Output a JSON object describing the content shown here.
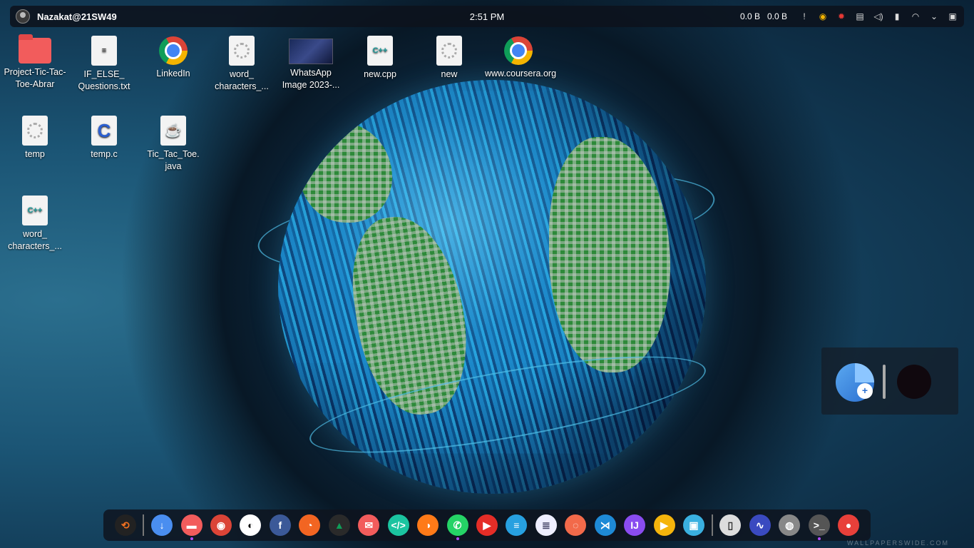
{
  "topbar": {
    "user": "Nazakat@21SW49",
    "clock": "2:51 PM",
    "net_down": "0.0 B",
    "net_up": "0.0 B",
    "tray_icons": [
      "notification-icon",
      "chrome-icon",
      "settings-gear-icon",
      "clipboard-icon",
      "volume-icon",
      "battery-icon",
      "wifi-icon",
      "chevron-down-icon",
      "screen-icon"
    ]
  },
  "desktop": {
    "icons": [
      {
        "label": "Project-Tic-Tac-Toe-Abrar",
        "kind": "folder"
      },
      {
        "label": "IF_ELSE_ Questions.txt",
        "kind": "text"
      },
      {
        "label": "LinkedIn",
        "kind": "chrome"
      },
      {
        "label": "word_ characters_...",
        "kind": "exec"
      },
      {
        "label": "WhatsApp Image 2023-...",
        "kind": "image"
      },
      {
        "label": "new.cpp",
        "kind": "cpp",
        "badge": "C++"
      },
      {
        "label": "new",
        "kind": "exec"
      },
      {
        "label": "www.coursera.org",
        "kind": "chrome"
      },
      {
        "label": "temp",
        "kind": "exec"
      },
      {
        "label": "temp.c",
        "kind": "c",
        "badge": "C"
      },
      {
        "label": "Tic_Tac_Toe. java",
        "kind": "java",
        "badge": "☕"
      },
      {
        "label": "word_ characters_...",
        "kind": "cpp",
        "badge": "C++"
      }
    ]
  },
  "widget": {
    "plus": "+"
  },
  "dock": {
    "items": [
      {
        "name": "app-launcher-icon",
        "glyph": "⟲",
        "bg": "#222",
        "fg": "#f07020"
      },
      {
        "name": "download-manager-icon",
        "glyph": "↓",
        "bg": "#4a8ef0"
      },
      {
        "name": "files-icon",
        "glyph": "▬",
        "bg": "#f25c5c",
        "active": true
      },
      {
        "name": "chrome-icon",
        "glyph": "◉",
        "bg": "#db4437"
      },
      {
        "name": "github-icon",
        "glyph": "◐",
        "bg": "#fff",
        "fg": "#000"
      },
      {
        "name": "facebook-icon",
        "glyph": "f",
        "bg": "#3b5998"
      },
      {
        "name": "rss-icon",
        "glyph": "◔",
        "bg": "#f26522"
      },
      {
        "name": "google-drive-icon",
        "glyph": "▲",
        "bg": "#2a2a2a",
        "fg": "#0f9d58"
      },
      {
        "name": "mail-icon",
        "glyph": "✉",
        "bg": "#f25c5c"
      },
      {
        "name": "code-editor-icon",
        "glyph": "</>",
        "bg": "#1bc4a0"
      },
      {
        "name": "firefox-icon",
        "glyph": "◑",
        "bg": "#ff7a18"
      },
      {
        "name": "whatsapp-icon",
        "glyph": "✆",
        "bg": "#25d366",
        "active": true
      },
      {
        "name": "youtube-icon",
        "glyph": "▶",
        "bg": "#e52d27"
      },
      {
        "name": "stack-icon",
        "glyph": "≡",
        "bg": "#27a0e0"
      },
      {
        "name": "notes-icon",
        "glyph": "≣",
        "bg": "#eef",
        "fg": "#446"
      },
      {
        "name": "messages-icon",
        "glyph": "◌",
        "bg": "#f26a4a"
      },
      {
        "name": "vscode-icon",
        "glyph": "⋊",
        "bg": "#1e8ad6"
      },
      {
        "name": "intellij-icon",
        "glyph": "IJ",
        "bg": "#8a4cf0"
      },
      {
        "name": "media-player-icon",
        "glyph": "▶",
        "bg": "#f5b40c"
      },
      {
        "name": "screenshot-icon",
        "glyph": "▣",
        "bg": "#3ab0e0"
      },
      {
        "name": "phone-icon",
        "glyph": "▯",
        "bg": "#ddd",
        "fg": "#333"
      },
      {
        "name": "system-monitor-icon",
        "glyph": "∿",
        "bg": "#3a4ac0"
      },
      {
        "name": "disk-icon",
        "glyph": "◍",
        "bg": "#888"
      },
      {
        "name": "terminal-icon",
        "glyph": ">_",
        "bg": "#555",
        "active": true
      },
      {
        "name": "toggle-icon",
        "glyph": "●",
        "bg": "#e8403a"
      }
    ]
  },
  "watermark": "WALLPAPERSWIDE.COM"
}
